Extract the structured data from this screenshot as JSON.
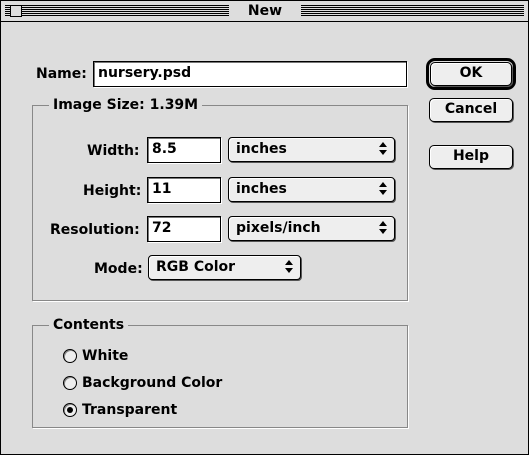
{
  "window": {
    "title": "New"
  },
  "name": {
    "label": "Name:",
    "value": "nursery.psd"
  },
  "image_size": {
    "title": "Image Size: 1.39M",
    "width": {
      "label": "Width:",
      "value": "8.5",
      "unit": "inches"
    },
    "height": {
      "label": "Height:",
      "value": "11",
      "unit": "inches"
    },
    "resolution": {
      "label": "Resolution:",
      "value": "72",
      "unit": "pixels/inch"
    },
    "mode": {
      "label": "Mode:",
      "value": "RGB Color"
    }
  },
  "contents": {
    "title": "Contents",
    "options": [
      {
        "label": "White",
        "selected": false
      },
      {
        "label": "Background Color",
        "selected": false
      },
      {
        "label": "Transparent",
        "selected": true
      }
    ]
  },
  "buttons": {
    "ok": "OK",
    "cancel": "Cancel",
    "help": "Help"
  }
}
